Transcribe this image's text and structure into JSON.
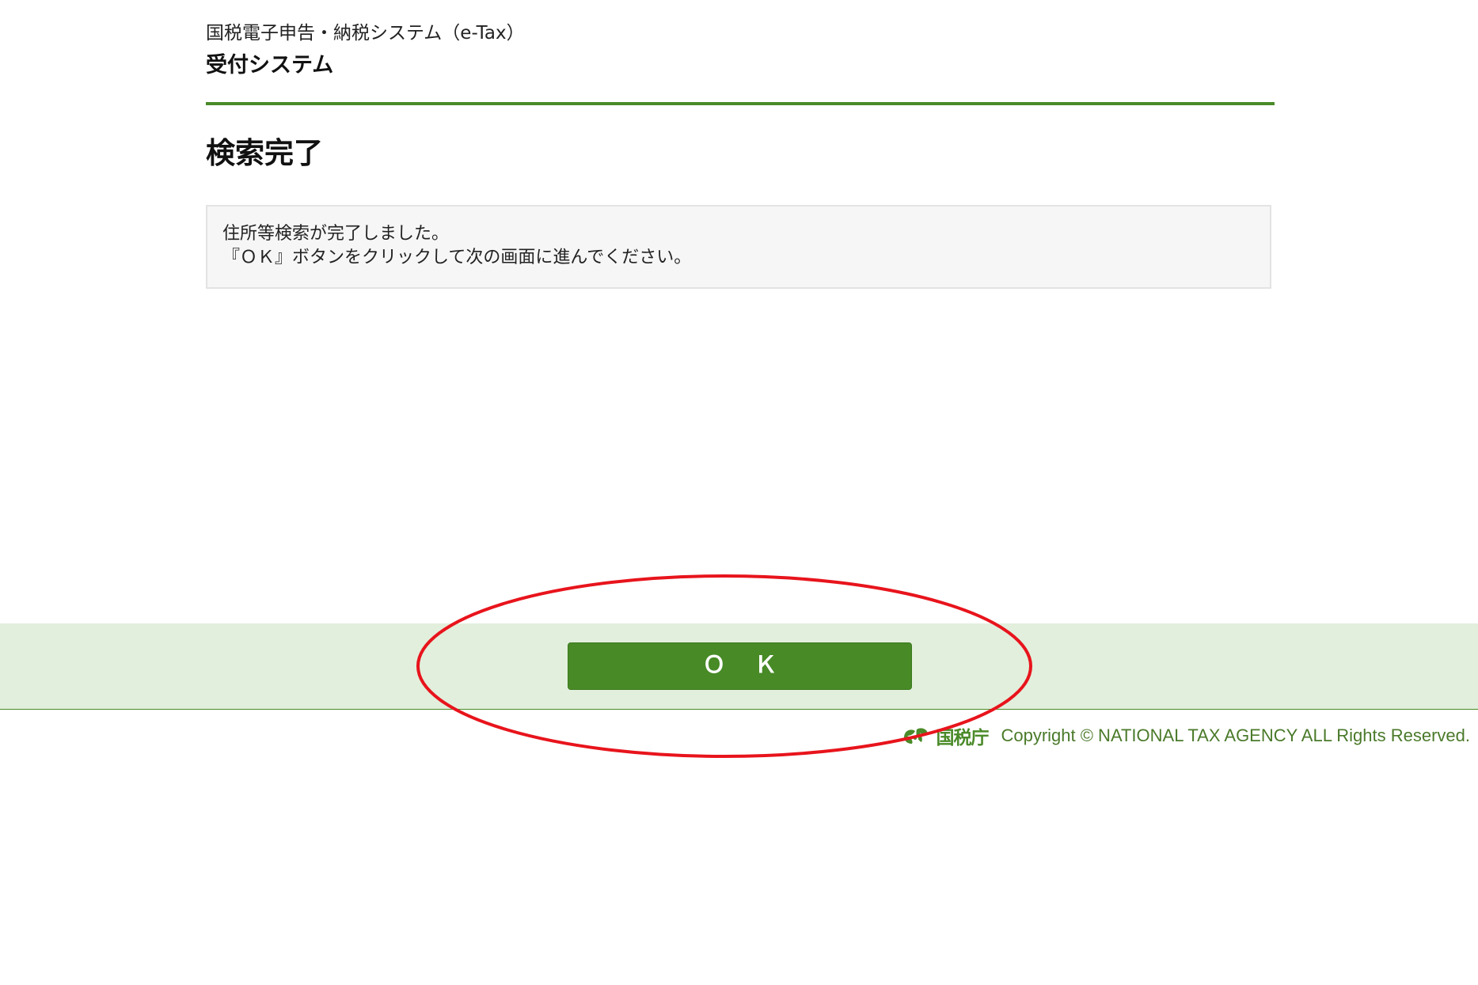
{
  "header": {
    "system_name": "国税電子申告・納税システム（e-Tax）",
    "subsystem_name": "受付システム"
  },
  "main": {
    "page_title": "検索完了",
    "message_lines": [
      "住所等検索が完了しました。",
      "『ＯＫ』ボタンをクリックして次の画面に進んでください。"
    ]
  },
  "actions": {
    "ok_label": "Ｏ Ｋ"
  },
  "footer": {
    "logo_text": "国税庁",
    "copyright": "Copyright © NATIONAL TAX AGENCY ALL Rights Reserved."
  },
  "colors": {
    "brand_green": "#478a26",
    "band_background": "#e2efdc",
    "annotation_red": "#e8141c"
  },
  "icons": {
    "logo_mark": "nta-leaf-logo-icon"
  }
}
